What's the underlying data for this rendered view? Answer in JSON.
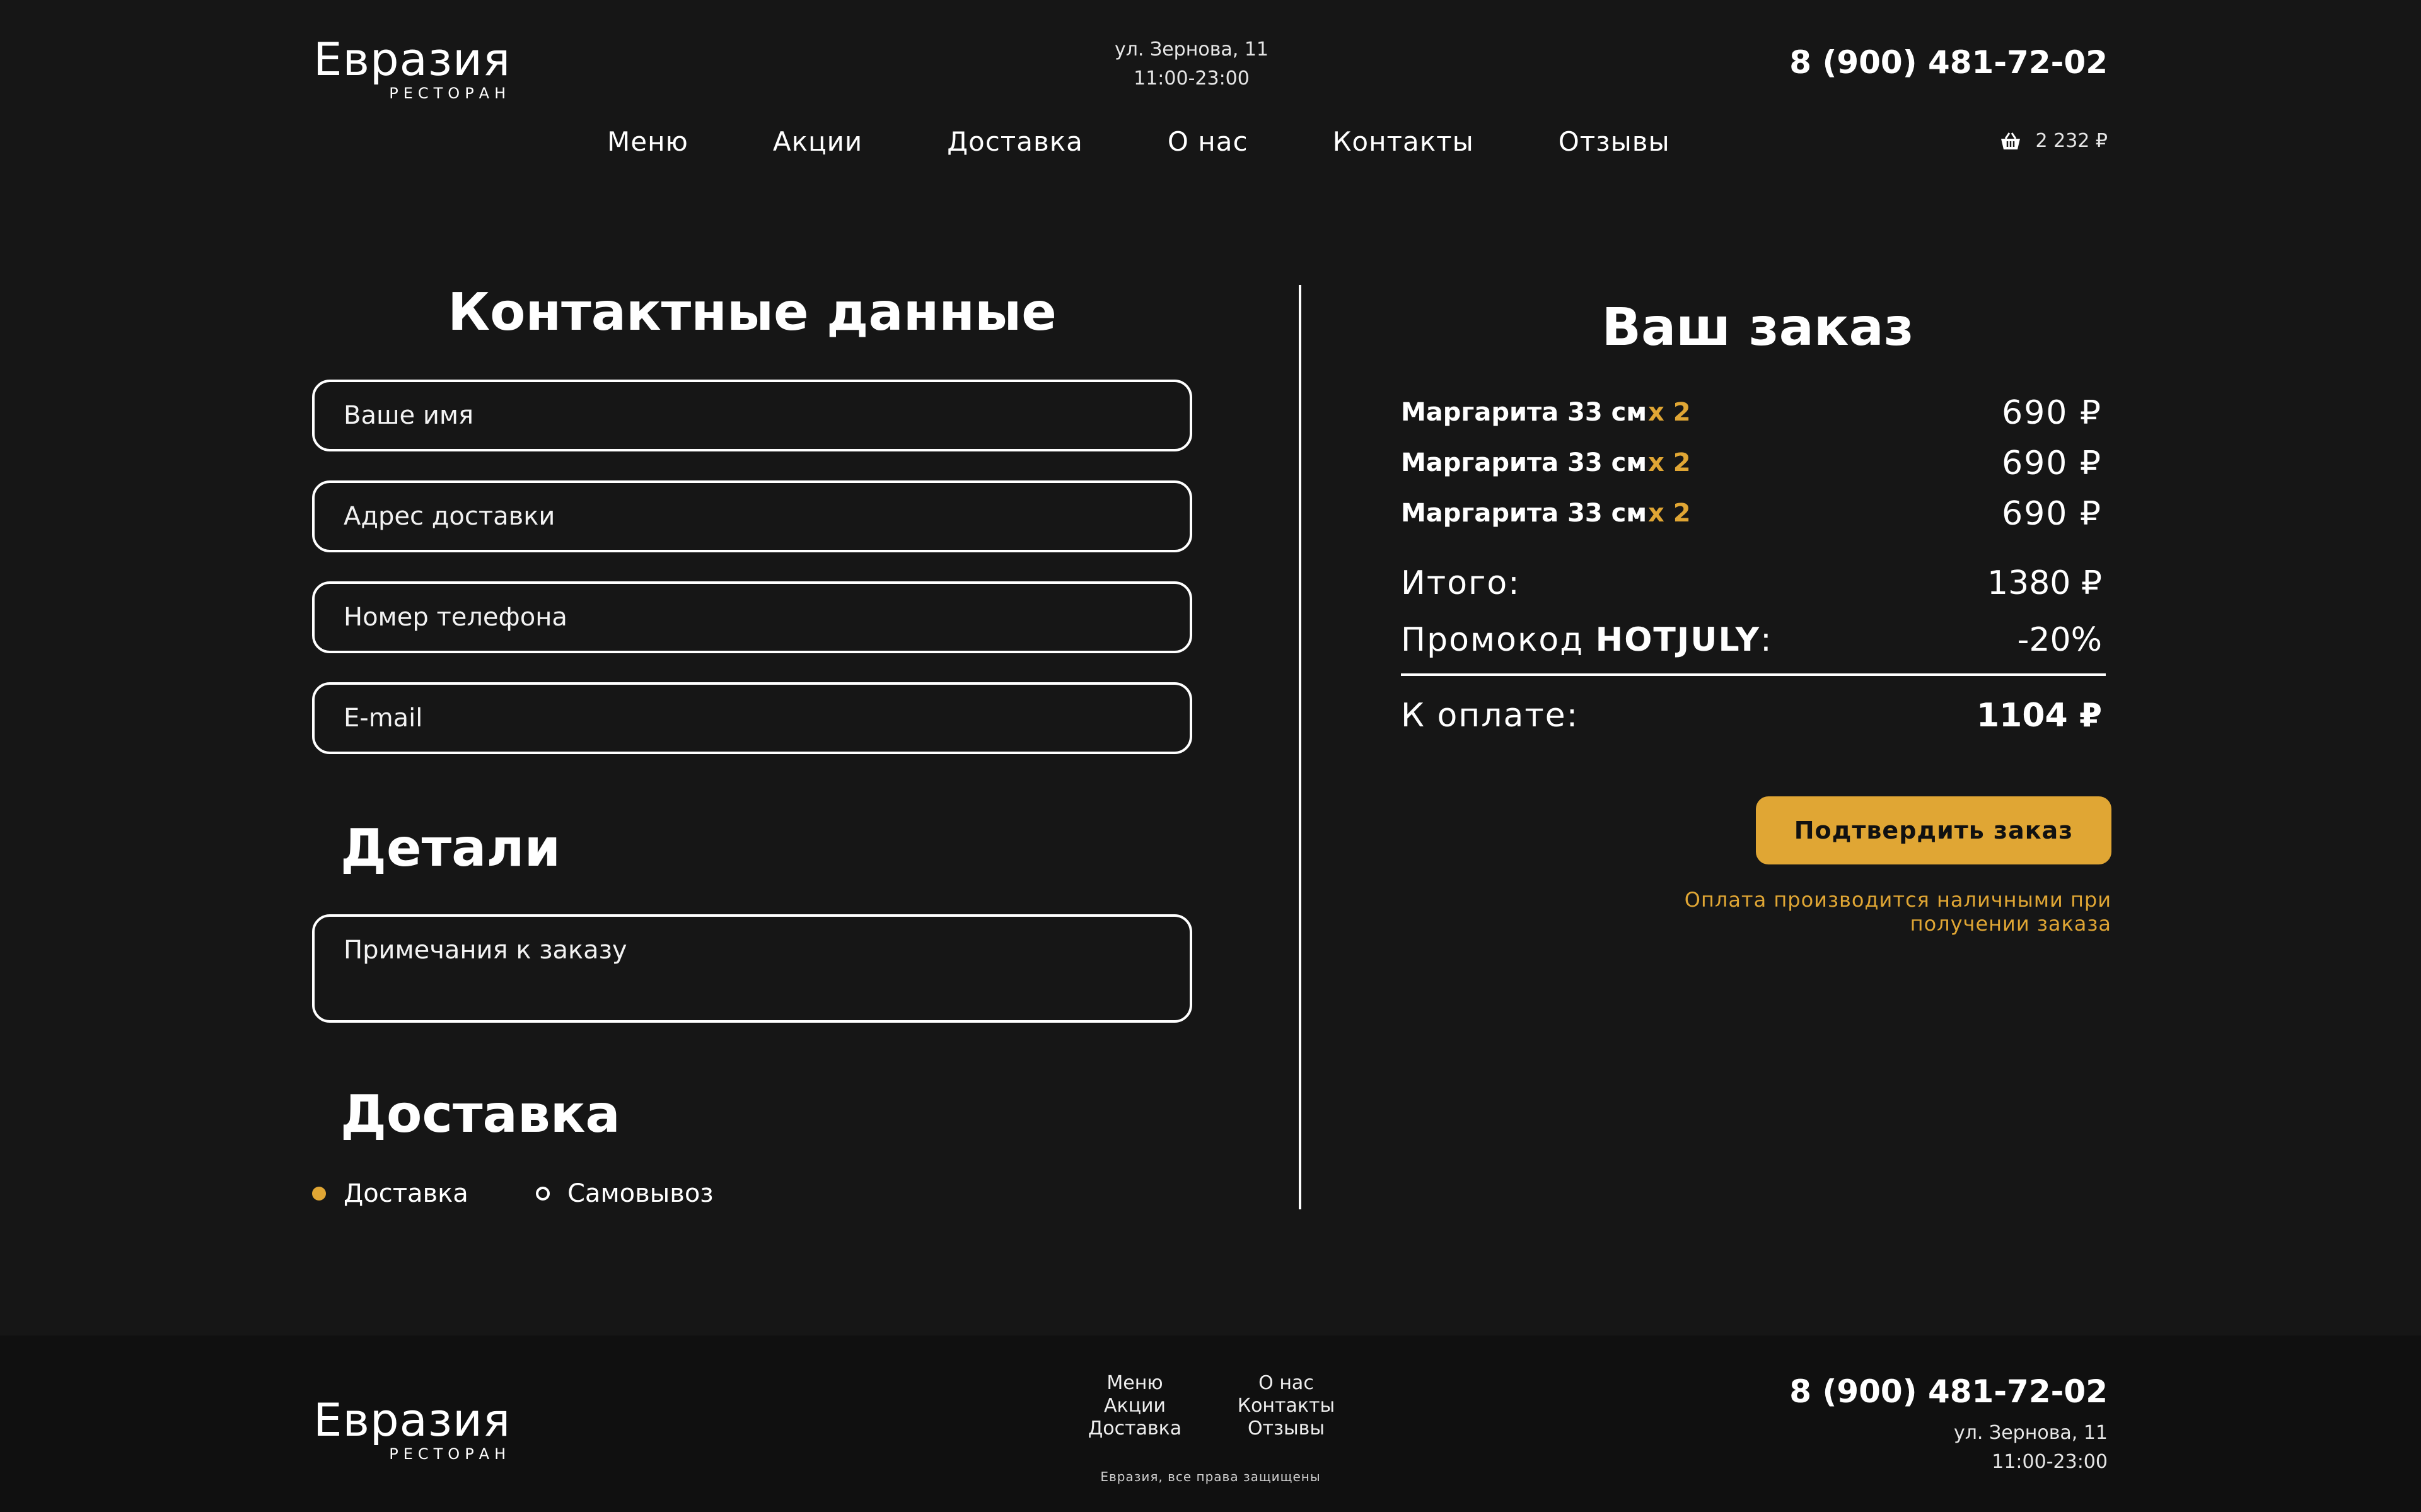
{
  "header": {
    "logo_name": "Евразия",
    "logo_sub": "РЕСТОРАН",
    "address": "ул. Зернова, 11",
    "hours": "11:00-23:00",
    "phone": "8 (900) 481-72-02",
    "nav": [
      "Меню",
      "Акции",
      "Доставка",
      "О нас",
      "Контакты",
      "Отзывы"
    ],
    "cart_total": "2 232 ₽"
  },
  "contact": {
    "title": "Контактные данные",
    "name_placeholder": "Ваше имя",
    "address_placeholder": "Адрес доставки",
    "phone_placeholder": "Номер телефона",
    "email_placeholder": "E-mail"
  },
  "details": {
    "title": "Детали",
    "notes_placeholder": "Примечания к заказу"
  },
  "delivery": {
    "title": "Доставка",
    "options": [
      "Доставка",
      "Самовывоз"
    ],
    "selected": "Доставка"
  },
  "order": {
    "title": "Ваш заказ",
    "items": [
      {
        "name": "Маргарита 33 см",
        "qty": "x 2",
        "price": "690 ₽"
      },
      {
        "name": "Маргарита 33 см",
        "qty": "x 2",
        "price": "690 ₽"
      },
      {
        "name": "Маргарита 33 см",
        "qty": "x 2",
        "price": "690 ₽"
      }
    ],
    "total_label": "Итого:",
    "total_value": "1380 ₽",
    "promo_label_prefix": "Промокод ",
    "promo_code": "HOTJULY",
    "promo_label_suffix": ":",
    "promo_value": "-20%",
    "pay_label": "К оплате:",
    "pay_value": "1104 ₽",
    "confirm_label": "Подтвердить заказ",
    "note": "Оплата производится наличными при получении заказа"
  },
  "footer": {
    "logo_name": "Евразия",
    "logo_sub": "РЕСТОРАН",
    "nav_col1": [
      "Меню",
      "Акции",
      "Доставка"
    ],
    "nav_col2": [
      "О нас",
      "Контакты",
      "Отзывы"
    ],
    "copyright": "Евразия, все права защищены",
    "phone": "8 (900) 481-72-02",
    "address": "ул. Зернова, 11",
    "hours": "11:00-23:00"
  },
  "colors": {
    "background": "#161616",
    "footer_background": "#101010",
    "accent": "#e0a634",
    "text": "#ffffff"
  }
}
